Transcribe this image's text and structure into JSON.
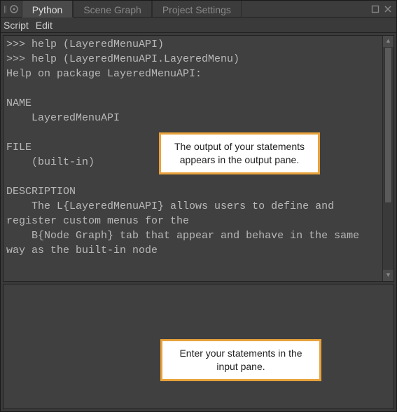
{
  "titlebar": {
    "tabs": [
      {
        "label": "Python",
        "active": true
      },
      {
        "label": "Scene Graph",
        "active": false
      },
      {
        "label": "Project Settings",
        "active": false
      }
    ]
  },
  "menubar": {
    "items": [
      "Script",
      "Edit"
    ]
  },
  "output": {
    "text": ">>> help (LayeredMenuAPI)\n>>> help (LayeredMenuAPI.LayeredMenu)\nHelp on package LayeredMenuAPI:\n\nNAME\n    LayeredMenuAPI\n\nFILE\n    (built-in)\n\nDESCRIPTION\n    The L{LayeredMenuAPI} allows users to define and register custom menus for the\n    B{Node Graph} tab that appear and behave in the same way as the built-in node"
  },
  "callouts": {
    "output_hint": "The output of your statements appears in the output pane.",
    "input_hint": "Enter your statements in the input pane."
  }
}
